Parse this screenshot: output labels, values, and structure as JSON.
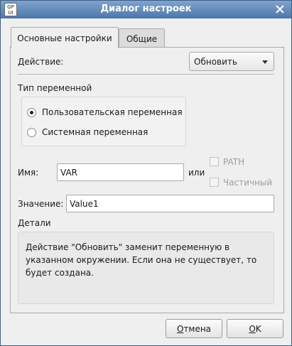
{
  "window": {
    "title": "Диалог настроек",
    "app_icon_text": "GP UI"
  },
  "tabs": [
    {
      "label": "Основные настройки",
      "active": true
    },
    {
      "label": "Общие",
      "active": false
    }
  ],
  "action": {
    "label": "Действие:",
    "selected": "Обновить"
  },
  "variable_type": {
    "title": "Тип переменной",
    "options": [
      {
        "label": "Пользовательская переменная",
        "checked": true
      },
      {
        "label": "Системная переменная",
        "checked": false
      }
    ]
  },
  "name": {
    "label": "Имя:",
    "value": "VAR",
    "or_label": "или"
  },
  "checkboxes": [
    {
      "label": "PATH",
      "checked": false,
      "enabled": false
    },
    {
      "label": "Частичный",
      "checked": false,
      "enabled": false
    }
  ],
  "value_field": {
    "label": "Значение:",
    "value": "Value1"
  },
  "details": {
    "title": "Детали",
    "text": "Действие \"Обновить\" заменит переменную в указанном окружении. Если она не существует, то будет создана."
  },
  "buttons": {
    "cancel_prefix": "",
    "cancel_mnemonic": "О",
    "cancel_rest": "тмена",
    "ok_mnemonic": "О",
    "ok_rest": "K"
  },
  "colors": {
    "titlebar_top": "#7ea4cf",
    "titlebar_bottom": "#4d76a8",
    "window_bg": "#efefef"
  }
}
